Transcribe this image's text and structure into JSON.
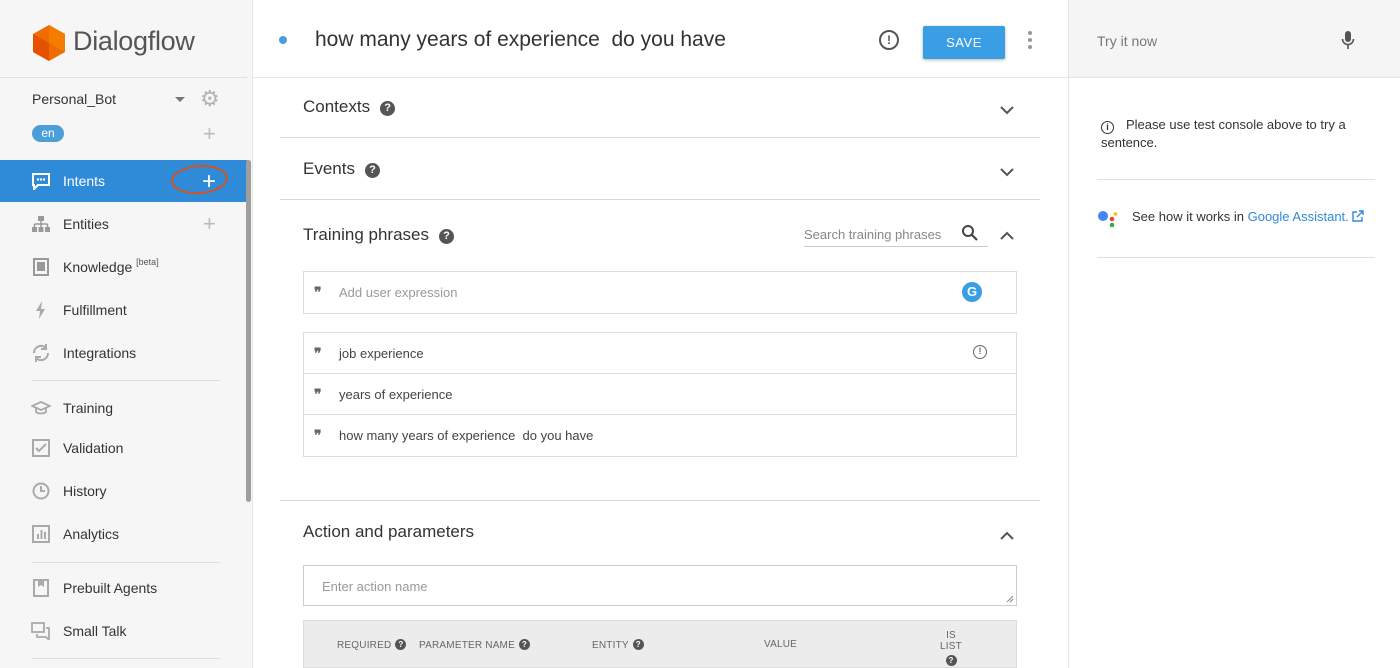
{
  "sidebar": {
    "logo_text": "Dialogflow",
    "agent_name": "Personal_Bot",
    "language": "en",
    "items": [
      {
        "label": "Intents"
      },
      {
        "label": "Entities"
      },
      {
        "label": "Knowledge",
        "badge": "[beta]"
      },
      {
        "label": "Fulfillment"
      },
      {
        "label": "Integrations"
      },
      {
        "label": "Training"
      },
      {
        "label": "Validation"
      },
      {
        "label": "History"
      },
      {
        "label": "Analytics"
      },
      {
        "label": "Prebuilt Agents"
      },
      {
        "label": "Small Talk"
      }
    ]
  },
  "header": {
    "intent_title": "how many years of experience  do you have",
    "save_label": "SAVE"
  },
  "sections": {
    "contexts": "Contexts",
    "events": "Events",
    "training_phrases": "Training phrases",
    "action_parameters": "Action and parameters"
  },
  "training": {
    "search_placeholder": "Search training phrases",
    "add_placeholder": "Add user expression",
    "phrases": [
      "job experience",
      "years of experience",
      "how many years of experience  do you have"
    ]
  },
  "action": {
    "placeholder": "Enter action name",
    "columns": [
      "REQUIRED",
      "PARAMETER NAME",
      "ENTITY",
      "VALUE",
      "IS LIST"
    ]
  },
  "right_panel": {
    "try_placeholder": "Try it now",
    "info_text": "Please use test console above to try a sentence.",
    "ga_prefix": "See how it works in ",
    "ga_link": "Google Assistant."
  },
  "colors": {
    "accent": "#2f8ad8",
    "save_button": "#3a9ee4",
    "annotation": "#d4531f"
  }
}
